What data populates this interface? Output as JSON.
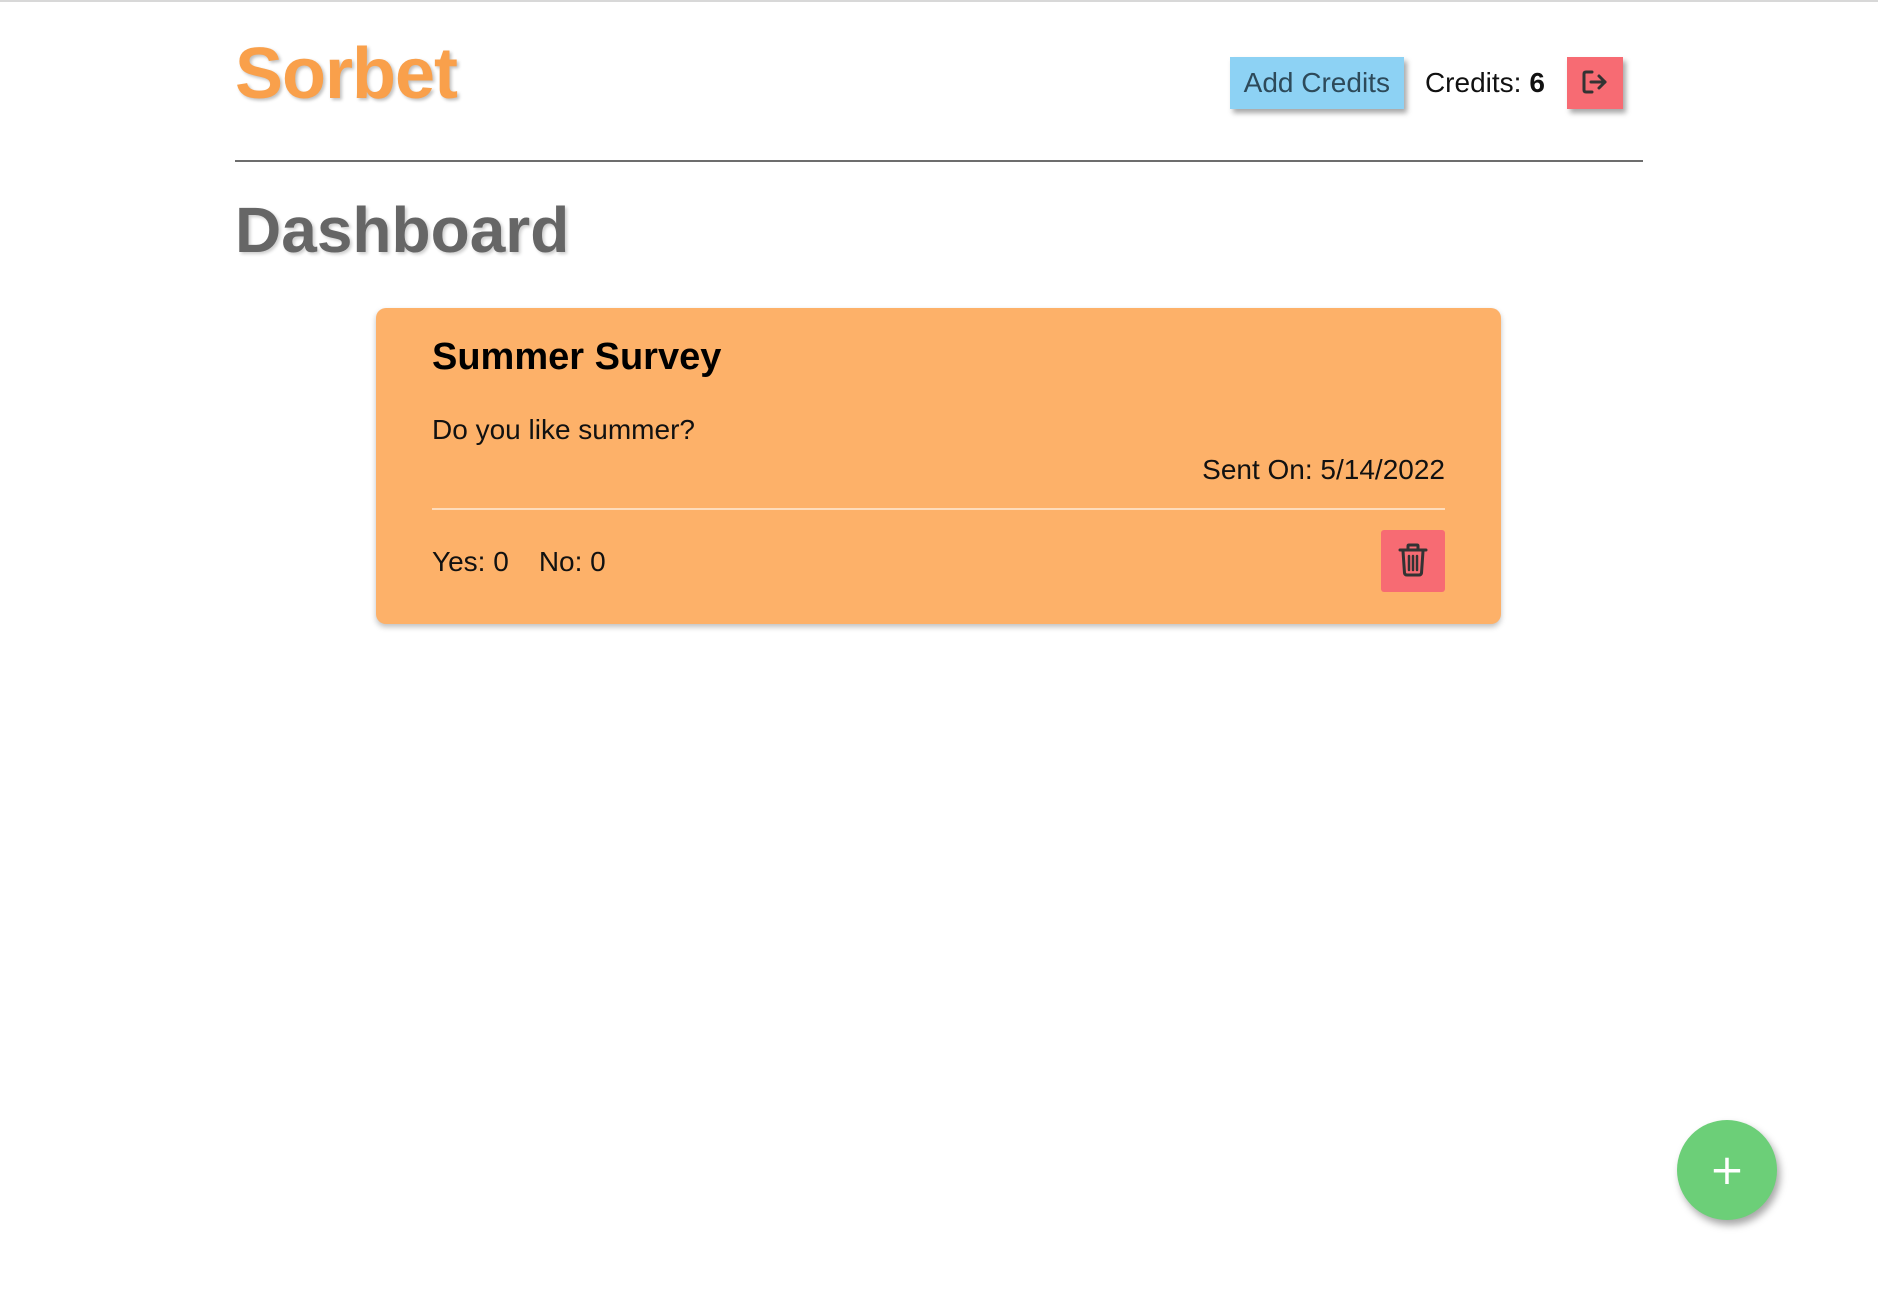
{
  "colors": {
    "brand": "#f9a04b",
    "add_credits_bg": "#8dd2f4",
    "logout_bg": "#f76b73",
    "card_bg": "#fdb169",
    "delete_bg": "#f76b73",
    "fab_bg": "#6ccf78",
    "title": "#666666"
  },
  "header": {
    "brand": "Sorbet",
    "add_credits_label": "Add Credits",
    "credits_label": "Credits:",
    "credits_value": "6",
    "logout_icon": "sign-out-icon"
  },
  "page": {
    "title": "Dashboard"
  },
  "surveys": [
    {
      "title": "Summer Survey",
      "body": "Do you like summer?",
      "sent_on": "Sent On: 5/14/2022",
      "yes": "Yes: 0",
      "no": "No: 0",
      "delete_icon": "trash-icon"
    }
  ],
  "fab": {
    "label": "+",
    "icon": "plus-icon"
  }
}
